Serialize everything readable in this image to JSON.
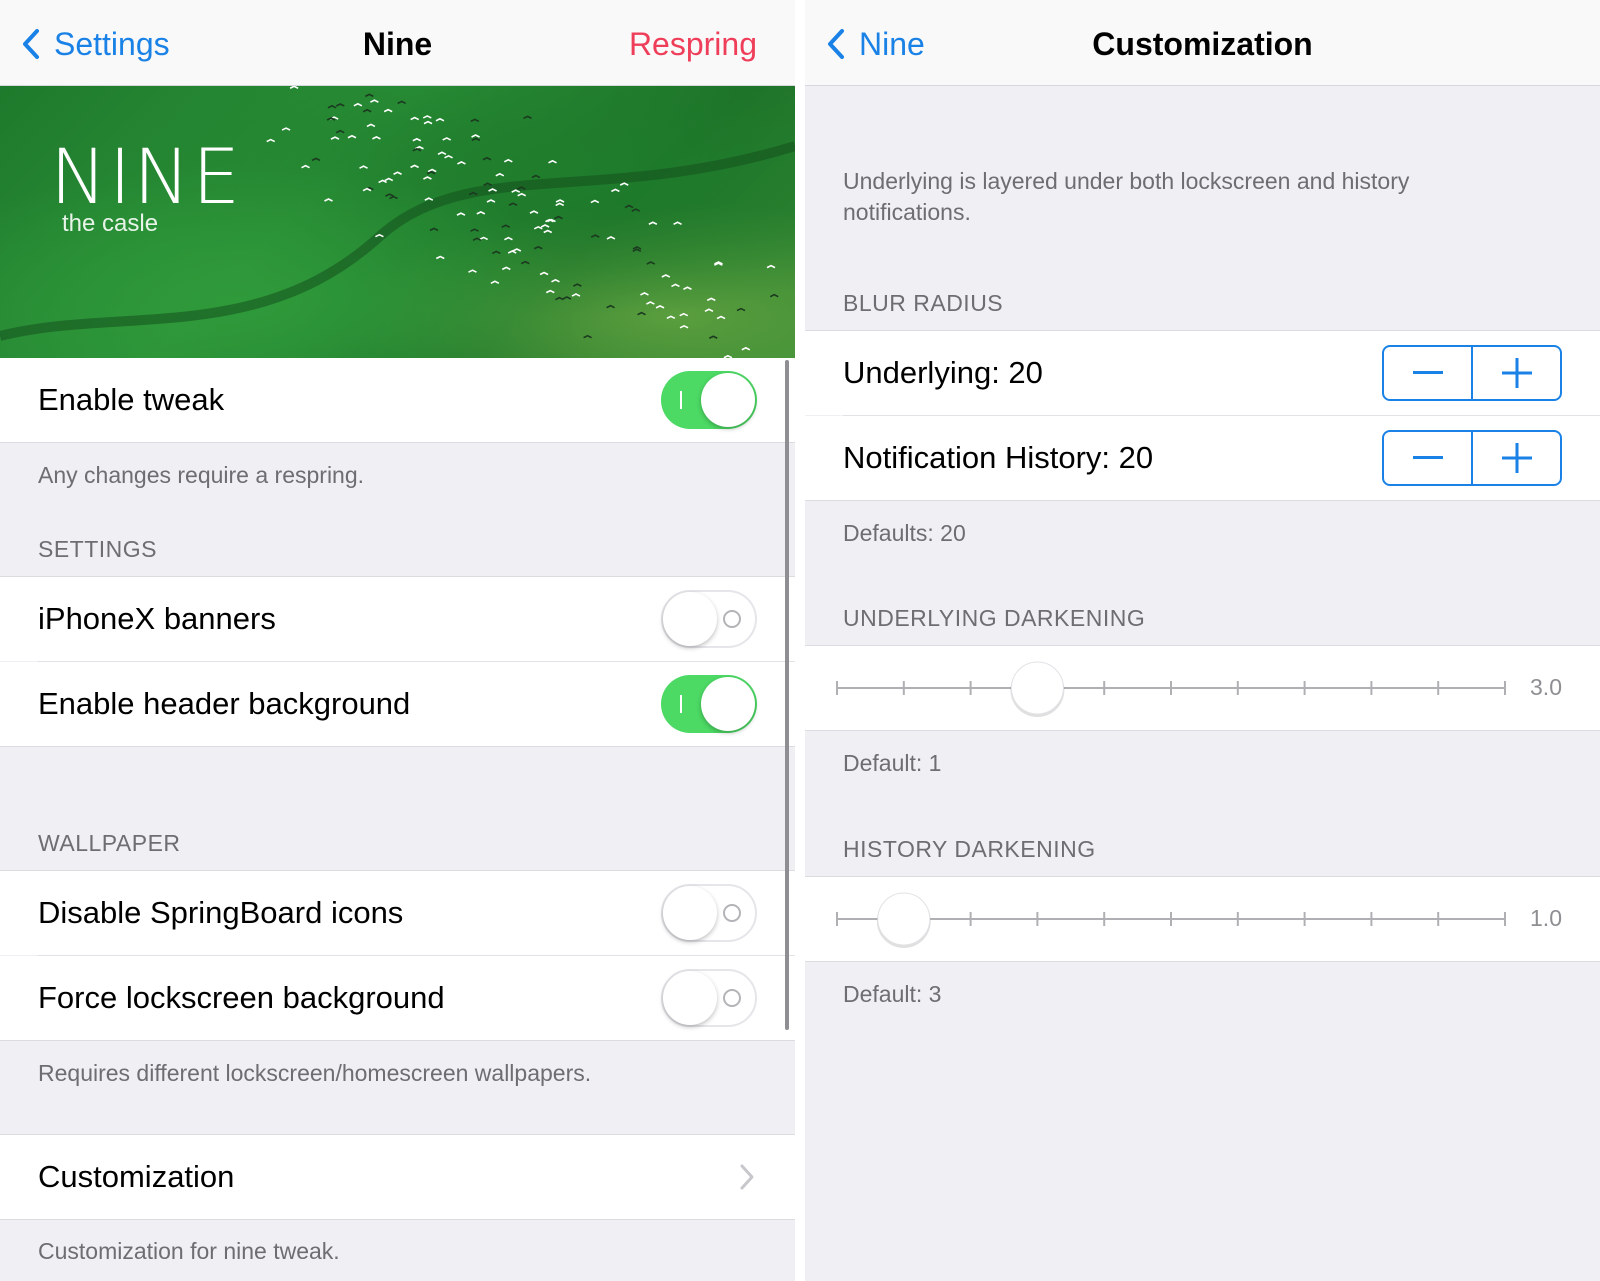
{
  "left": {
    "nav": {
      "back_label": "Settings",
      "title": "Nine",
      "action_label": "Respring"
    },
    "banner": {
      "title": "NINE",
      "subtitle": "the casle"
    },
    "enable_tweak": {
      "label": "Enable tweak",
      "on": true
    },
    "enable_footer": "Any changes require a respring.",
    "settings_header": "SETTINGS",
    "settings_items": [
      {
        "label": "iPhoneX banners",
        "on": false
      },
      {
        "label": "Enable header background",
        "on": true
      }
    ],
    "wallpaper_header": "WALLPAPER",
    "wallpaper_items": [
      {
        "label": "Disable SpringBoard icons",
        "on": false
      },
      {
        "label": "Force lockscreen background",
        "on": false
      }
    ],
    "wallpaper_footer": "Requires different lockscreen/homescreen wallpapers.",
    "customization": {
      "label": "Customization"
    },
    "customization_footer": "Customization for nine tweak."
  },
  "right": {
    "nav": {
      "back_label": "Nine",
      "title": "Customization"
    },
    "intro": "Underlying is layered under both lockscreen and history notifications.",
    "blur_header": "BLUR RADIUS",
    "blur_items": [
      {
        "label": "Underlying: 20"
      },
      {
        "label": "Notification History: 20"
      }
    ],
    "blur_footer": "Defaults: 20",
    "underlying_header": "UNDERLYING DARKENING",
    "underlying_slider": {
      "value": 3.0,
      "min": 0,
      "max": 10,
      "value_label": "3.0"
    },
    "underlying_footer": "Default: 1",
    "history_header": "HISTORY DARKENING",
    "history_slider": {
      "value": 1.0,
      "min": 0,
      "max": 10,
      "value_label": "1.0"
    },
    "history_footer": "Default: 3"
  },
  "colors": {
    "accent": "#1a82e6",
    "destructive": "#ef3e5a",
    "switch_on": "#4cd964",
    "grouped_bg": "#efeff4"
  },
  "icons": {
    "back": "chevron-left-icon",
    "disclosure": "chevron-right-icon",
    "minus": "minus-icon",
    "plus": "plus-icon"
  }
}
